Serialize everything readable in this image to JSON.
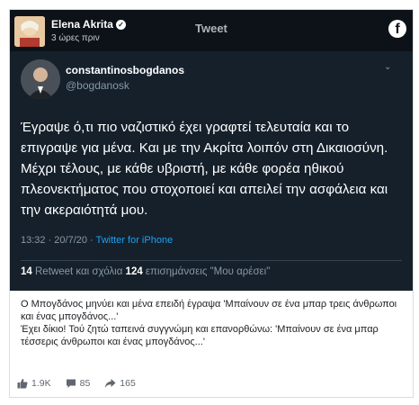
{
  "header": {
    "author_name": "Elena Akrita",
    "time": "3 ώρες πριν",
    "center_label": "Tweet",
    "logo": "facebook-icon"
  },
  "tweet": {
    "name": "constantinosbogdanos",
    "handle": "@bogdanosk",
    "text": "Έγραψε ό,τι πιο ναζιστικό έχει γραφτεί τελευταία και το επιγραψε για μένα. Και με την Ακρίτα λοιπόν στη Δικαιοσύνη. Μέχρι τέλους, με κάθε υβριστή, με κάθε φορέα ηθικού πλεονεκτήματος που στοχοποιεί και απειλεί την ασφάλεια και την ακεραιότητά μου.",
    "timestamp": "13:32 · 20/7/20 · ",
    "source": "Twitter for iPhone",
    "retweets_count": "14",
    "retweets_label": " Retweet και σχόλια  ",
    "likes_count": "124",
    "likes_label": " επισημάνσεις \"Μου αρέσει\""
  },
  "caption": {
    "line1": "Ο Μπογδάνος μηνύει και μένα επειδή έγραψα 'Μπαίνουν σε ένα μπαρ τρεις άνθρωποι και ένας μπογδάνος...'",
    "line2": "Έχει δίκιο! Τού ζητώ ταπεινά συγγνώμη και επανορθώνω: 'Μπαίνουν σε ένα μπαρ τέσσερις άνθρωποι και ένας μπογδάνος...'"
  },
  "reactions": {
    "likes": "1.9K",
    "comments": "85",
    "shares": "165"
  }
}
